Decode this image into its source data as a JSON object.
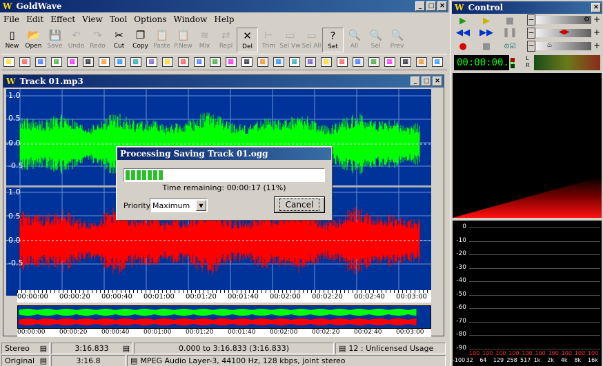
{
  "app": {
    "title": "GoldWave",
    "logo": "W"
  },
  "menu": [
    "File",
    "Edit",
    "Effect",
    "View",
    "Tool",
    "Options",
    "Window",
    "Help"
  ],
  "toolbar1": [
    {
      "label": "New",
      "icon": "new-document-icon",
      "glyph": "▯",
      "enabled": true
    },
    {
      "label": "Open",
      "icon": "open-folder-icon",
      "glyph": "📂",
      "enabled": true
    },
    {
      "label": "Save",
      "icon": "save-disk-icon",
      "glyph": "💾",
      "enabled": false
    },
    {
      "label": "Undo",
      "icon": "undo-icon",
      "glyph": "↶",
      "enabled": false
    },
    {
      "label": "Redo",
      "icon": "redo-icon",
      "glyph": "↷",
      "enabled": false
    },
    {
      "label": "Cut",
      "icon": "scissors-icon",
      "glyph": "✂",
      "enabled": true
    },
    {
      "label": "Copy",
      "icon": "copy-icon",
      "glyph": "❐",
      "enabled": true
    },
    {
      "label": "Paste",
      "icon": "paste-icon",
      "glyph": "📋",
      "enabled": false
    },
    {
      "label": "P.New",
      "icon": "paste-new-icon",
      "glyph": "📋",
      "enabled": false
    },
    {
      "label": "Mix",
      "icon": "mix-icon",
      "glyph": "≋",
      "enabled": false
    },
    {
      "label": "Repl",
      "icon": "replace-icon",
      "glyph": "⇄",
      "enabled": false
    },
    {
      "label": "Del",
      "icon": "delete-icon",
      "glyph": "✕",
      "enabled": true,
      "pressed": true
    },
    {
      "label": "Trim",
      "icon": "trim-icon",
      "glyph": "⊢",
      "enabled": false
    },
    {
      "label": "Sel Vw",
      "icon": "select-view-icon",
      "glyph": "▭",
      "enabled": false
    },
    {
      "label": "Sel All",
      "icon": "select-all-icon",
      "glyph": "▭",
      "enabled": false
    },
    {
      "label": "Set",
      "icon": "set-marker-icon",
      "glyph": "?",
      "enabled": true,
      "pressed": true
    },
    {
      "label": "All",
      "icon": "zoom-all-icon",
      "glyph": "🔍",
      "enabled": false
    },
    {
      "label": "Sel",
      "icon": "zoom-select-icon",
      "glyph": "🔍",
      "enabled": false
    },
    {
      "label": "Prev",
      "icon": "zoom-prev-icon",
      "glyph": "🔍",
      "enabled": false
    }
  ],
  "toolbar2_icons": [
    "channel-select-icon",
    "channel-swap-icon",
    "invert-icon",
    "expand-icon",
    "flatten-icon",
    "loop-icon",
    "equalizer-icon",
    "noise-icon",
    "spectrum-grid-icon",
    "time-grid-icon",
    "reverse-icon",
    "bars-icon",
    "color-grid-icon",
    "color-bars-icon",
    "eye-icon",
    "palette-icon",
    "crossfade-icon",
    "fade-icon",
    "filter-icon",
    "pitch-icon",
    "circle-icon",
    "speed-icon",
    "doppler-icon",
    "ring-icon",
    "bang-icon",
    "gate-icon",
    "hz-icon",
    "freq-icon"
  ],
  "track": {
    "title": "Track 01.mp3",
    "ylabels_top": [
      "1.0",
      "0.5",
      "0.0",
      "-0.5"
    ],
    "ylabels_bottom": [
      "1.0",
      "0.5",
      "0.0",
      "-0.5"
    ],
    "timeline": [
      "00:00:00",
      "00:00:20",
      "00:00:40",
      "00:01:00",
      "00:01:20",
      "00:01:40",
      "00:02:00",
      "00:02:20",
      "00:02:40",
      "00:03:00"
    ],
    "colors": {
      "background": "#003399",
      "left": "#00ff00",
      "right": "#ff0000",
      "grid": "#6a8fd8"
    }
  },
  "dialog": {
    "title": "Processing Saving Track 01.ogg",
    "progress_segments": 7,
    "time_remaining": "Time remaining: 00:00:17 (11%)",
    "priority_label": "Priority:",
    "priority_value": "Maximum",
    "cancel_label": "Cancel"
  },
  "status": {
    "row1": {
      "channels": "Stereo",
      "length": "3:16.833",
      "range": "0.000 to 3:16.833 (3:16.833)",
      "license": "12 : Unlicensed Usage"
    },
    "row2": {
      "mode": "Original",
      "length": "3:16.8",
      "format": "MPEG Audio Layer-3, 44100 Hz, 128 kbps, joint stereo"
    }
  },
  "control": {
    "title": "Control",
    "time": "00:00:00.0",
    "lr": [
      "L",
      "R"
    ],
    "db_labels": [
      "0",
      "-10",
      "-20",
      "-30",
      "-40",
      "-50",
      "-60",
      "-70",
      "-80",
      "-90"
    ],
    "freq_labels": [
      "-100",
      "32",
      "64",
      "129",
      "258",
      "517",
      "1k",
      "2k",
      "4k",
      "8k",
      "16k"
    ],
    "freq_values": [
      "100",
      "100",
      "100",
      "100",
      "100",
      "100",
      "100",
      "100",
      "100",
      "100"
    ],
    "plus": "+",
    "minus": "−"
  }
}
